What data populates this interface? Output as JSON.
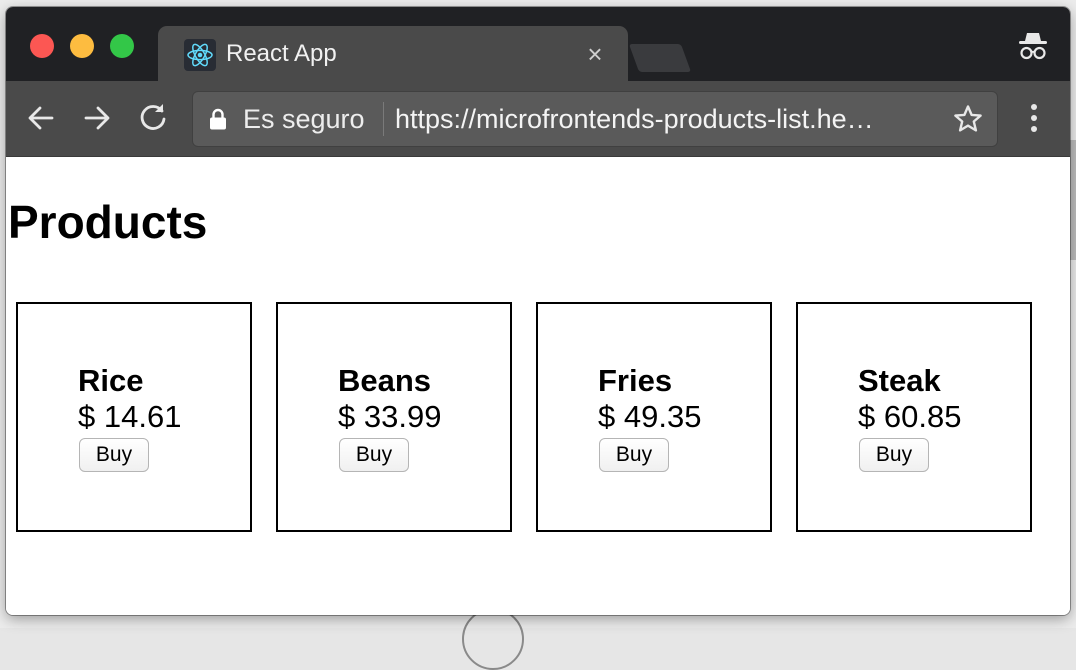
{
  "tab": {
    "title": "React App",
    "close_glyph": "×",
    "favicon_icon": "react-logo-icon"
  },
  "toolbar": {
    "secure_label": "Es seguro",
    "url": "https://microfrontends-products-list.he…"
  },
  "page": {
    "title": "Products"
  },
  "products": [
    {
      "name": "Rice",
      "price": "$ 14.61",
      "buy_label": "Buy"
    },
    {
      "name": "Beans",
      "price": "$ 33.99",
      "buy_label": "Buy"
    },
    {
      "name": "Fries",
      "price": "$ 49.35",
      "buy_label": "Buy"
    },
    {
      "name": "Steak",
      "price": "$ 60.85",
      "buy_label": "Buy"
    }
  ],
  "colors": {
    "titlebar": "#202124",
    "toolbar": "#4a4a4a",
    "close_button": "#fc5753",
    "minimize_button": "#fdbc40",
    "zoom_button": "#33c748",
    "react_logo": "#61dafb"
  },
  "icons": [
    "back-arrow-icon",
    "forward-arrow-icon",
    "reload-icon",
    "lock-icon",
    "star-icon",
    "menu-dots-icon",
    "incognito-icon"
  ]
}
